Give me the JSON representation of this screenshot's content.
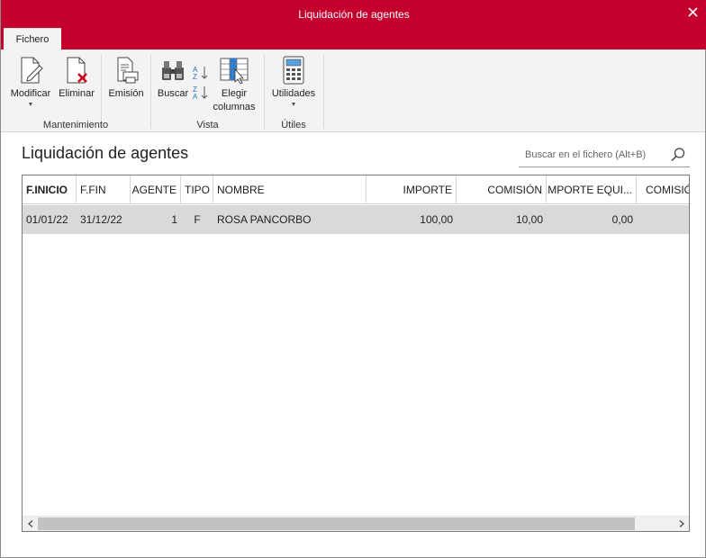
{
  "window": {
    "title": "Liquidación de agentes"
  },
  "tabs": [
    {
      "label": "Fichero",
      "active": true
    }
  ],
  "ribbon": {
    "groups": [
      {
        "label": "Mantenimiento",
        "buttons": [
          {
            "label": "Modificar",
            "icon": "edit-document-icon",
            "dropdown": true
          },
          {
            "label": "Eliminar",
            "icon": "delete-document-icon"
          },
          {
            "label": "Emisión",
            "icon": "print-document-icon"
          }
        ]
      },
      {
        "label": "Vista",
        "buttons": [
          {
            "label": "Buscar",
            "icon": "binoculars-icon"
          },
          {
            "label": "Elegir",
            "label2": "columnas",
            "icon": "choose-columns-icon"
          }
        ],
        "sort_icons": [
          "sort-az-icon",
          "sort-za-icon"
        ]
      },
      {
        "label": "Útiles",
        "buttons": [
          {
            "label": "Utilidades",
            "icon": "calculator-icon",
            "dropdown": true
          }
        ]
      }
    ]
  },
  "page": {
    "title": "Liquidación de agentes"
  },
  "search": {
    "placeholder": "Buscar en el fichero (Alt+B)",
    "value": ""
  },
  "table": {
    "columns": [
      "F.INICIO",
      "F.FIN",
      "AGENTE",
      "TIPO",
      "NOMBRE",
      "IMPORTE",
      "COMISIÓN",
      "IMPORTE EQUI...",
      "COMISIÓ"
    ],
    "rows": [
      [
        "01/01/22",
        "31/12/22",
        "1",
        "F",
        "ROSA PANCORBO",
        "100,00",
        "10,00",
        "0,00",
        ""
      ]
    ]
  },
  "colors": {
    "accent": "#c4002f",
    "ribbon_bg": "#f3f3f3",
    "selected_row": "#d9d9d9"
  }
}
